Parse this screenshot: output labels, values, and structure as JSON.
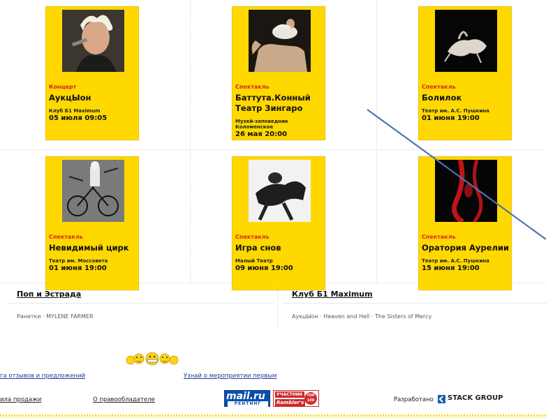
{
  "events": [
    {
      "category": "Концерт",
      "title": "АукцЫон",
      "venue": "Клуб Б1 Maximum",
      "date": "05 июля 09:05"
    },
    {
      "category": "Спектакль",
      "title": "Баттута.Конный Театр Зингаро",
      "venue": "Музей-заповедник Коломенское",
      "date": "26 мая 20:00"
    },
    {
      "category": "Спектакль",
      "title": "Болилок",
      "venue": "Театр им. А.С. Пушкина",
      "date": "01 июня 19:00"
    },
    {
      "category": "Спектакль",
      "title": "Невидимый цирк",
      "venue": "Театр им. Моссовета",
      "date": "01 июня 19:00"
    },
    {
      "category": "Спектакль",
      "title": "Игра снов",
      "venue": "Малый Театр",
      "date": "09 июня 19:00"
    },
    {
      "category": "Спектакль",
      "title": "Оратория Аурелии",
      "venue": "Театр им. А.С. Пушкина",
      "date": "15 июня 19:00"
    }
  ],
  "sections": [
    {
      "title": "Поп и Эстрада",
      "links": "Ранетки · MYLENE FARMER"
    },
    {
      "title": "Клуб Б1 Maximum",
      "links": "АукцЫон · Heaven and Hell · The Sisters of Mercy"
    }
  ],
  "footer": {
    "feedback_link": "га отзывов и предложений",
    "subscribe_link": "Узнай о мероприятии первым",
    "rules_link": "ила продажи",
    "copyright_link": "О правообладателе",
    "developed_by": "Разработано",
    "developer": "STACK GROUP",
    "mailru_top": "mail.ru",
    "mailru_bottom": "РЕЙТИНГ",
    "rambler_top": "УЧАСТНИК",
    "rambler_bottom": "Rambler's",
    "rambler_circle": "TOP 100"
  },
  "colors": {
    "card": "#ffd800",
    "category": "#d6261f",
    "link": "#1d3d8f",
    "annotation_line": "#4a74b8"
  },
  "icons": [
    "smiley-group-icon",
    "stack-group-logo-icon"
  ]
}
